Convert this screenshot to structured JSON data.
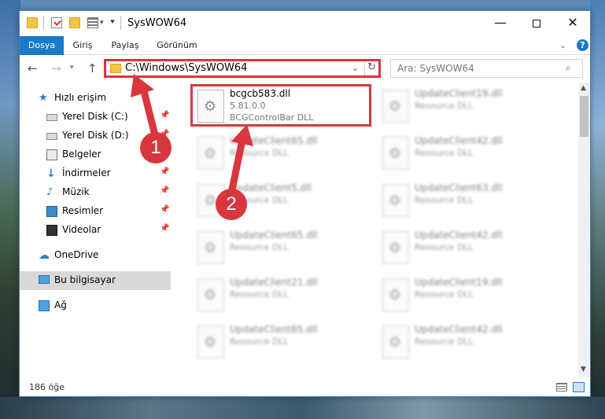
{
  "window": {
    "title": "SysWOW64",
    "minimize_glyph": "—",
    "close_glyph": "✕"
  },
  "ribbon": {
    "tabs": [
      "Dosya",
      "Giriş",
      "Paylaş",
      "Görünüm"
    ],
    "help_label": "?"
  },
  "nav": {
    "address": "C:\\Windows\\SysWOW64",
    "search_placeholder": "Ara: SysWOW64"
  },
  "sidebar": {
    "items": [
      {
        "label": "Hızlı erişim",
        "icon": "star-icon"
      },
      {
        "label": "Yerel Disk (C:)",
        "icon": "drive-icon",
        "pinned": true
      },
      {
        "label": "Yerel Disk (D:)",
        "icon": "drive-icon",
        "pinned": true
      },
      {
        "label": "Belgeler",
        "icon": "documents-icon"
      },
      {
        "label": "İndirmeler",
        "icon": "downloads-icon",
        "pinned": true
      },
      {
        "label": "Müzik",
        "icon": "music-icon",
        "pinned": true
      },
      {
        "label": "Resimler",
        "icon": "pictures-icon",
        "pinned": true
      },
      {
        "label": "Videolar",
        "icon": "videos-icon",
        "pinned": true
      },
      {
        "label": "OneDrive",
        "icon": "onedrive-icon"
      },
      {
        "label": "Bu bilgisayar",
        "icon": "this-pc-icon",
        "selected": true
      },
      {
        "label": "Ağ",
        "icon": "network-icon"
      }
    ]
  },
  "files": [
    {
      "name": "bcgcb583.dll",
      "version": "5.81.0.0",
      "description": "BCGControlBar DLL",
      "highlighted": true
    },
    {
      "name": "UpdateClient19.dll",
      "description": "Resource DLL"
    },
    {
      "name": "UpdateClient65.dll",
      "description": "Resource DLL"
    },
    {
      "name": "UpdateClient42.dll",
      "description": "Resource DLL"
    },
    {
      "name": "UpdateClient5.dll",
      "description": "Resource DLL"
    },
    {
      "name": "UpdateClient63.dll",
      "description": "Resource DLL"
    },
    {
      "name": "UpdateClient65.dll",
      "description": "Resource DLL"
    },
    {
      "name": "UpdateClient42.dll",
      "description": "Resource DLL"
    },
    {
      "name": "UpdateClient21.dll",
      "description": "Resource DLL"
    },
    {
      "name": "UpdateClient19.dll",
      "description": "Resource DLL"
    },
    {
      "name": "UpdateClient65.dll",
      "description": "Resource DLL"
    },
    {
      "name": "UpdateClient42.dll",
      "description": "Resource DLL"
    }
  ],
  "status": {
    "item_count": "186 öğe"
  },
  "callouts": [
    "1",
    "2"
  ],
  "colors": {
    "accent": "#1979ca",
    "highlight": "#d9363e"
  }
}
